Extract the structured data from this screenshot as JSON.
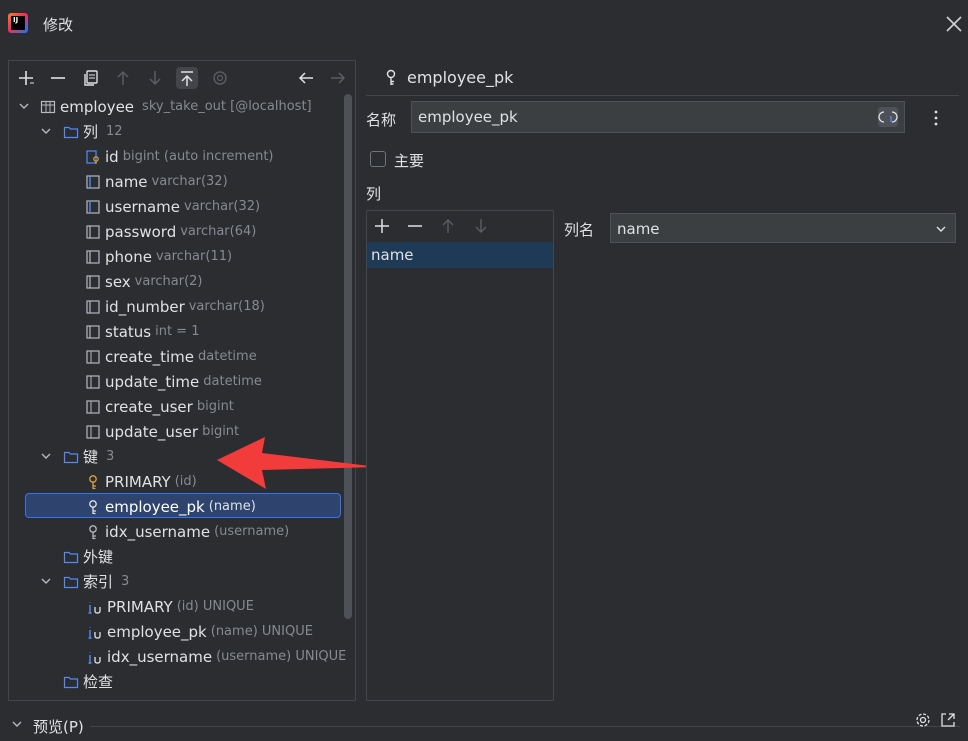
{
  "window": {
    "title": "修改"
  },
  "tree": {
    "table": {
      "name": "employee",
      "meta": "sky_take_out [@localhost]"
    },
    "columns_folder": {
      "label": "列",
      "count": "12"
    },
    "columns": [
      {
        "name": "id",
        "type": "bigint (auto increment)"
      },
      {
        "name": "name",
        "type": "varchar(32)"
      },
      {
        "name": "username",
        "type": "varchar(32)"
      },
      {
        "name": "password",
        "type": "varchar(64)"
      },
      {
        "name": "phone",
        "type": "varchar(11)"
      },
      {
        "name": "sex",
        "type": "varchar(2)"
      },
      {
        "name": "id_number",
        "type": "varchar(18)"
      },
      {
        "name": "status",
        "type": "int = 1"
      },
      {
        "name": "create_time",
        "type": "datetime"
      },
      {
        "name": "update_time",
        "type": "datetime"
      },
      {
        "name": "create_user",
        "type": "bigint"
      },
      {
        "name": "update_user",
        "type": "bigint"
      }
    ],
    "keys_folder": {
      "label": "键",
      "count": "3"
    },
    "keys": [
      {
        "name": "PRIMARY",
        "cols": "(id)"
      },
      {
        "name": "employee_pk",
        "cols": "(name)"
      },
      {
        "name": "idx_username",
        "cols": "(username)"
      }
    ],
    "foreign_keys_folder": {
      "label": "外键"
    },
    "indexes_folder": {
      "label": "索引",
      "count": "3"
    },
    "indexes": [
      {
        "name": "PRIMARY",
        "cols": "(id) UNIQUE"
      },
      {
        "name": "employee_pk",
        "cols": "(name) UNIQUE"
      },
      {
        "name": "idx_username",
        "cols": "(username) UNIQUE"
      }
    ],
    "checks_folder": {
      "label": "检查"
    }
  },
  "detail": {
    "title": "employee_pk",
    "name_label": "名称",
    "name_value": "employee_pk",
    "primary_label": "主要",
    "columns_label": "列",
    "columns_list": [
      "name"
    ],
    "column_name_label": "列名",
    "column_name_value": "name"
  },
  "footer": {
    "preview_label": "预览(P)"
  },
  "colors": {
    "accent": "#3574f0",
    "selection": "#2e436e",
    "arrow": "#f23b3b",
    "folder": "#548af7",
    "key": "#d9a343"
  }
}
